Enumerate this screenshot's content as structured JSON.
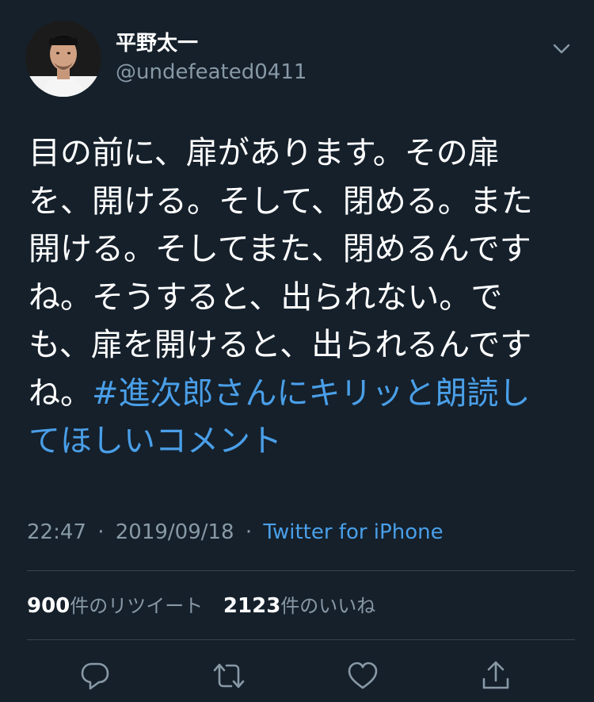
{
  "user": {
    "display_name": "平野太一",
    "handle": "@undefeated0411"
  },
  "tweet": {
    "lines": [
      "目の前に、扉があります。その扉",
      "を、開ける。そして、閉める。また",
      "開ける。そしてまた、閉めるんです",
      "ね。そうすると、出られない。で",
      "も、扉を開けると、出られるんです"
    ],
    "line6_prefix": "ね。",
    "hashtag_line1": "#進次郎さんにキリッと朗読し",
    "hashtag_line2": "てほしいコメント"
  },
  "meta": {
    "time": "22:47",
    "separator": "·",
    "date": "2019/09/18",
    "source": "Twitter for iPhone"
  },
  "stats": {
    "retweets_count": "900",
    "retweets_label": "件のリツイート",
    "likes_count": "2123",
    "likes_label": "件のいいね"
  },
  "colors": {
    "background": "#15202b",
    "link": "#4a9fe8",
    "secondary_text": "#8899a6",
    "divider": "#38444d"
  },
  "icons": {
    "avatar": "profile-photo",
    "chevron": "chevron-down-icon",
    "reply": "reply-icon",
    "retweet": "retweet-icon",
    "like": "heart-icon",
    "share": "share-icon"
  }
}
